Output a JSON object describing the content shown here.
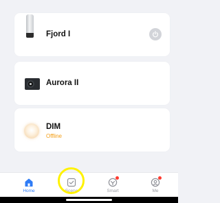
{
  "devices": [
    {
      "name": "Fjord I",
      "status": "",
      "image": "water-heater",
      "has_power_button": true
    },
    {
      "name": "Aurora II",
      "status": "",
      "image": "heat-pump-unit",
      "has_power_button": false
    },
    {
      "name": "DIM",
      "status": "Offline",
      "image": "round-lamp",
      "has_power_button": false
    }
  ],
  "tabbar": {
    "items": [
      {
        "label": "Home",
        "icon": "home-icon",
        "active": true,
        "badge": false
      },
      {
        "label": "Scene",
        "icon": "scene-icon",
        "active": false,
        "badge": false
      },
      {
        "label": "Smart",
        "icon": "smart-icon",
        "active": false,
        "badge": true
      },
      {
        "label": "Me",
        "icon": "me-icon",
        "active": false,
        "badge": true
      }
    ]
  },
  "colors": {
    "background": "#f1f2f6",
    "accent": "#2f7cf6",
    "offline": "#f39c12",
    "badge": "#ff3b30",
    "highlight": "#fff200"
  }
}
